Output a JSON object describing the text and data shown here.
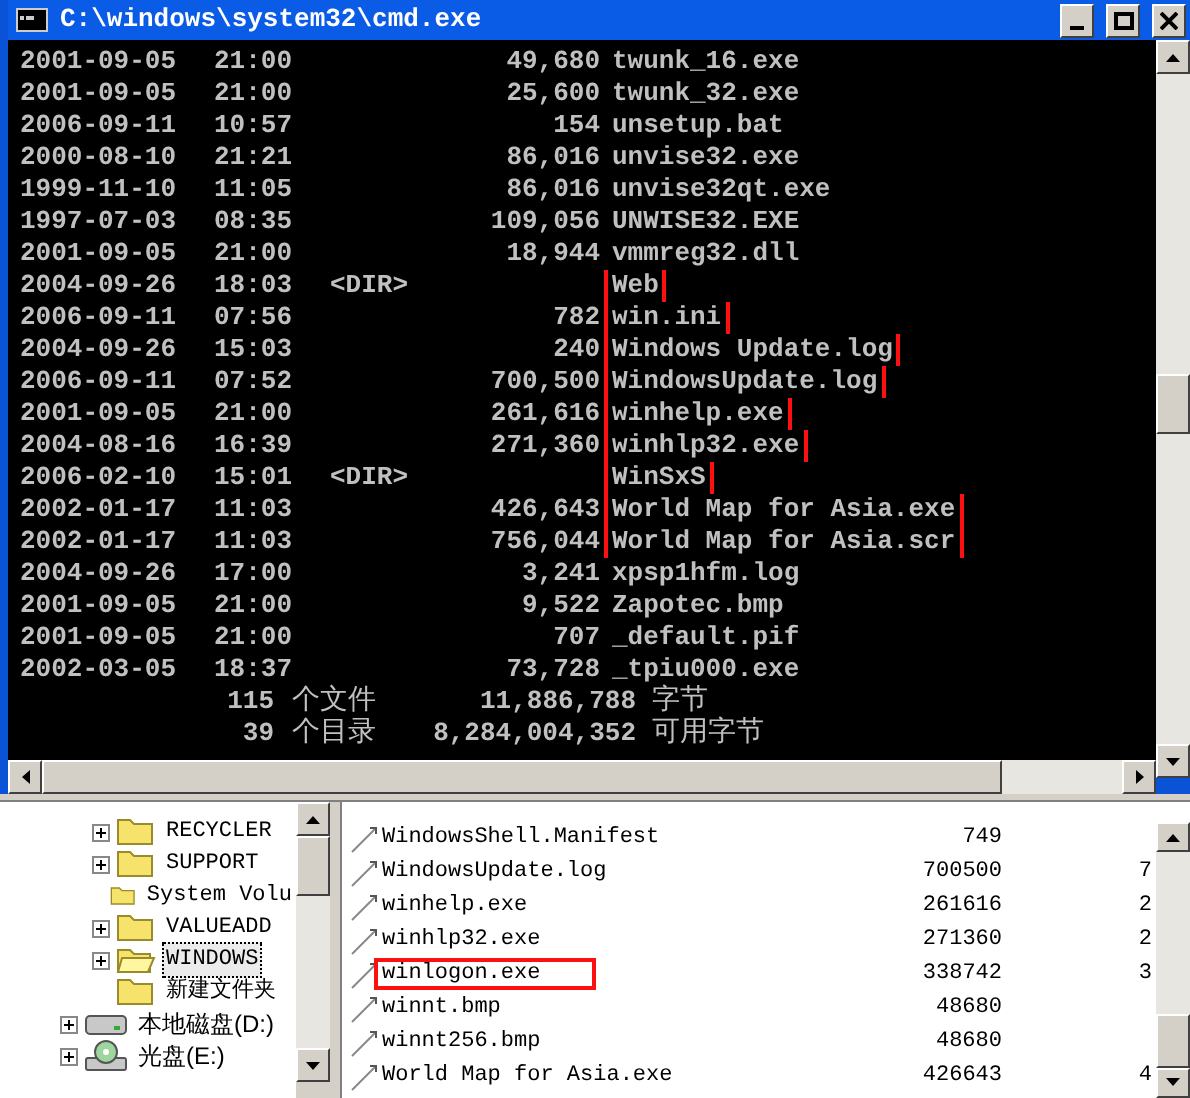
{
  "window": {
    "title": "C:\\windows\\system32\\cmd.exe"
  },
  "console": {
    "rows": [
      {
        "date": "2001-09-05",
        "time": "21:00",
        "dir": "",
        "size": "49,680",
        "name": "twunk_16.exe",
        "highlighted": false
      },
      {
        "date": "2001-09-05",
        "time": "21:00",
        "dir": "",
        "size": "25,600",
        "name": "twunk_32.exe",
        "highlighted": false
      },
      {
        "date": "2006-09-11",
        "time": "10:57",
        "dir": "",
        "size": "154",
        "name": "unsetup.bat",
        "highlighted": false
      },
      {
        "date": "2000-08-10",
        "time": "21:21",
        "dir": "",
        "size": "86,016",
        "name": "unvise32.exe",
        "highlighted": false
      },
      {
        "date": "1999-11-10",
        "time": "11:05",
        "dir": "",
        "size": "86,016",
        "name": "unvise32qt.exe",
        "highlighted": false
      },
      {
        "date": "1997-07-03",
        "time": "08:35",
        "dir": "",
        "size": "109,056",
        "name": "UNWISE32.EXE",
        "highlighted": false
      },
      {
        "date": "2001-09-05",
        "time": "21:00",
        "dir": "",
        "size": "18,944",
        "name": "vmmreg32.dll",
        "highlighted": false
      },
      {
        "date": "2004-09-26",
        "time": "18:03",
        "dir": "<DIR>",
        "size": "",
        "name": "Web",
        "highlighted": true
      },
      {
        "date": "2006-09-11",
        "time": "07:56",
        "dir": "",
        "size": "782",
        "name": "win.ini",
        "highlighted": true
      },
      {
        "date": "2004-09-26",
        "time": "15:03",
        "dir": "",
        "size": "240",
        "name": "Windows Update.log",
        "highlighted": true
      },
      {
        "date": "2006-09-11",
        "time": "07:52",
        "dir": "",
        "size": "700,500",
        "name": "WindowsUpdate.log",
        "highlighted": true
      },
      {
        "date": "2001-09-05",
        "time": "21:00",
        "dir": "",
        "size": "261,616",
        "name": "winhelp.exe",
        "highlighted": true
      },
      {
        "date": "2004-08-16",
        "time": "16:39",
        "dir": "",
        "size": "271,360",
        "name": "winhlp32.exe",
        "highlighted": true
      },
      {
        "date": "2006-02-10",
        "time": "15:01",
        "dir": "<DIR>",
        "size": "",
        "name": "WinSxS",
        "highlighted": true
      },
      {
        "date": "2002-01-17",
        "time": "11:03",
        "dir": "",
        "size": "426,643",
        "name": "World Map for Asia.exe",
        "highlighted": true
      },
      {
        "date": "2002-01-17",
        "time": "11:03",
        "dir": "",
        "size": "756,044",
        "name": "World Map for Asia.scr",
        "highlighted": true
      },
      {
        "date": "2004-09-26",
        "time": "17:00",
        "dir": "",
        "size": "3,241",
        "name": "xpsp1hfm.log",
        "highlighted": false
      },
      {
        "date": "2001-09-05",
        "time": "21:00",
        "dir": "",
        "size": "9,522",
        "name": "Zapotec.bmp",
        "highlighted": false
      },
      {
        "date": "2001-09-05",
        "time": "21:00",
        "dir": "",
        "size": "707",
        "name": "_default.pif",
        "highlighted": false
      },
      {
        "date": "2002-03-05",
        "time": "18:37",
        "dir": "",
        "size": "73,728",
        "name": "_tpiu000.exe",
        "highlighted": false
      }
    ],
    "summary": [
      {
        "count": "115",
        "label": "个文件",
        "bytes": "11,886,788",
        "unit": "字节"
      },
      {
        "count": "39",
        "label": "个目录",
        "bytes": "8,284,004,352",
        "unit": "可用字节"
      }
    ]
  },
  "tree": {
    "items": [
      {
        "kind": "folder",
        "label": "RECYCLER",
        "expandable": true,
        "selected": false
      },
      {
        "kind": "folder",
        "label": "SUPPORT",
        "expandable": true,
        "selected": false
      },
      {
        "kind": "folder",
        "label": "System Volu",
        "expandable": false,
        "selected": false
      },
      {
        "kind": "folder",
        "label": "VALUEADD",
        "expandable": true,
        "selected": false
      },
      {
        "kind": "folder",
        "label": "WINDOWS",
        "expandable": true,
        "selected": true
      },
      {
        "kind": "folder",
        "label": "新建文件夹",
        "expandable": false,
        "selected": false
      },
      {
        "kind": "disk",
        "label": "本地磁盘(D:)",
        "expandable": true,
        "selected": false
      },
      {
        "kind": "cd",
        "label": "光盘(E:)",
        "expandable": true,
        "selected": false
      }
    ]
  },
  "files": {
    "rows": [
      {
        "name": "WindowsShell.Manifest",
        "size": "749",
        "column_3": "",
        "highlighted": false
      },
      {
        "name": "WindowsUpdate.log",
        "size": "700500",
        "column_3": "7",
        "highlighted": false
      },
      {
        "name": "winhelp.exe",
        "size": "261616",
        "column_3": "2",
        "highlighted": false
      },
      {
        "name": "winhlp32.exe",
        "size": "271360",
        "column_3": "2",
        "highlighted": false
      },
      {
        "name": "winlogon.exe",
        "size": "338742",
        "column_3": "3",
        "highlighted": true
      },
      {
        "name": "winnt.bmp",
        "size": "48680",
        "column_3": "",
        "highlighted": false
      },
      {
        "name": "winnt256.bmp",
        "size": "48680",
        "column_3": "",
        "highlighted": false
      },
      {
        "name": "World Map for Asia.exe",
        "size": "426643",
        "column_3": "4",
        "highlighted": false
      }
    ]
  }
}
